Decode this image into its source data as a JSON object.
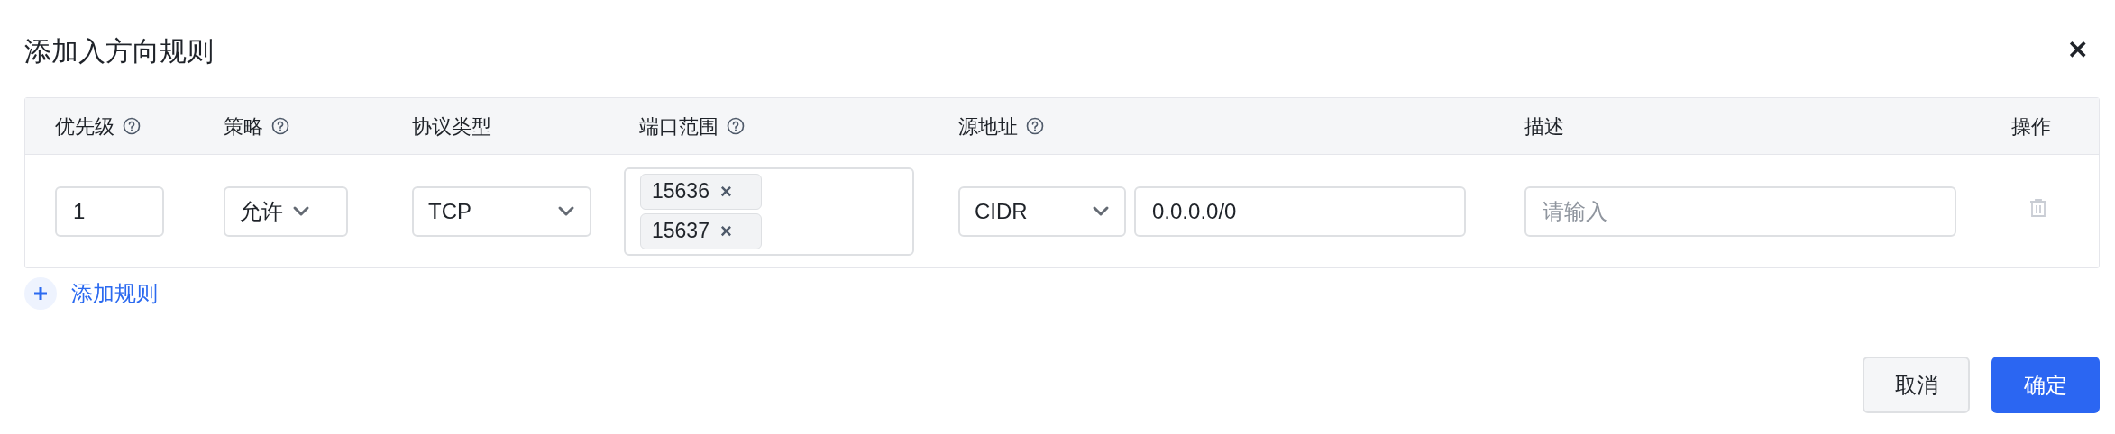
{
  "dialog": {
    "title": "添加入方向规则",
    "close": "✕"
  },
  "table": {
    "columns": [
      {
        "label": "优先级",
        "help": true
      },
      {
        "label": "策略",
        "help": true
      },
      {
        "label": "协议类型",
        "help": false
      },
      {
        "label": "端口范围",
        "help": true
      },
      {
        "label": "源地址",
        "help": true
      },
      {
        "label": "描述",
        "help": false
      },
      {
        "label": "操作",
        "help": false
      }
    ],
    "rows": [
      {
        "priority": "1",
        "policy": "允许",
        "protocol": "TCP",
        "ports": [
          {
            "value": "15636",
            "remove": "×"
          },
          {
            "value": "15637",
            "remove": "×"
          }
        ],
        "source_type": "CIDR",
        "source": "0.0.0.0/0",
        "description_placeholder": "请输入"
      }
    ]
  },
  "add_rule": "添加规则",
  "buttons": [
    {
      "label": "取消",
      "kind": "secondary"
    },
    {
      "label": "确定",
      "kind": "primary"
    }
  ]
}
